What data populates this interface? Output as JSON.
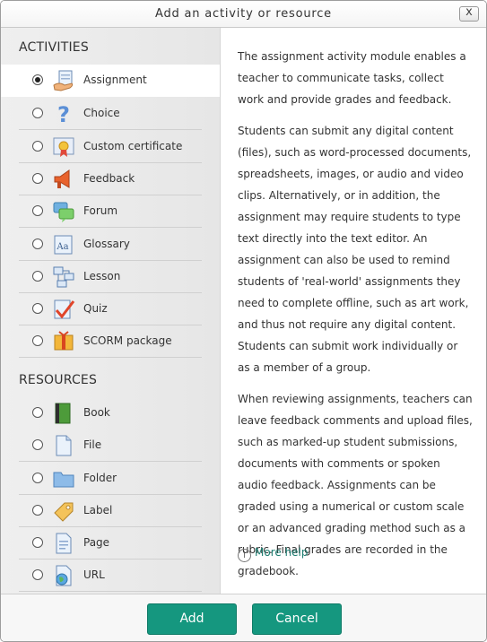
{
  "dialog": {
    "title": "Add an activity or resource",
    "close_label": "x"
  },
  "activities": {
    "heading": "ACTIVITIES",
    "items": [
      {
        "label": "Assignment",
        "selected": true,
        "icon": "assignment-icon"
      },
      {
        "label": "Choice",
        "selected": false,
        "icon": "choice-icon"
      },
      {
        "label": "Custom certificate",
        "selected": false,
        "icon": "certificate-icon"
      },
      {
        "label": "Feedback",
        "selected": false,
        "icon": "feedback-icon"
      },
      {
        "label": "Forum",
        "selected": false,
        "icon": "forum-icon"
      },
      {
        "label": "Glossary",
        "selected": false,
        "icon": "glossary-icon"
      },
      {
        "label": "Lesson",
        "selected": false,
        "icon": "lesson-icon"
      },
      {
        "label": "Quiz",
        "selected": false,
        "icon": "quiz-icon"
      },
      {
        "label": "SCORM package",
        "selected": false,
        "icon": "scorm-icon"
      }
    ]
  },
  "resources": {
    "heading": "RESOURCES",
    "items": [
      {
        "label": "Book",
        "selected": false,
        "icon": "book-icon"
      },
      {
        "label": "File",
        "selected": false,
        "icon": "file-icon"
      },
      {
        "label": "Folder",
        "selected": false,
        "icon": "folder-icon"
      },
      {
        "label": "Label",
        "selected": false,
        "icon": "label-icon"
      },
      {
        "label": "Page",
        "selected": false,
        "icon": "page-icon"
      },
      {
        "label": "URL",
        "selected": false,
        "icon": "url-icon"
      }
    ]
  },
  "description": {
    "paragraphs": [
      "The assignment activity module enables a teacher to communicate tasks, collect work and provide grades and feedback.",
      "Students can submit any digital content (files), such as word-processed documents, spreadsheets, images, or audio and video clips. Alternatively, or in addition, the assignment may require students to type text directly into the text editor. An assignment can also be used to remind students of 'real-world' assignments they need to complete offline, such as art work, and thus not require any digital content. Students can submit work individually or as a member of a group.",
      "When reviewing assignments, teachers can leave feedback comments and upload files, such as marked-up student submissions, documents with comments or spoken audio feedback. Assignments can be graded using a numerical or custom scale or an advanced grading method such as a rubric. Final grades are recorded in the gradebook."
    ],
    "more_help": "More help"
  },
  "footer": {
    "add_label": "Add",
    "cancel_label": "Cancel"
  },
  "colors": {
    "accent": "#15977f",
    "link": "#1f7e72"
  }
}
